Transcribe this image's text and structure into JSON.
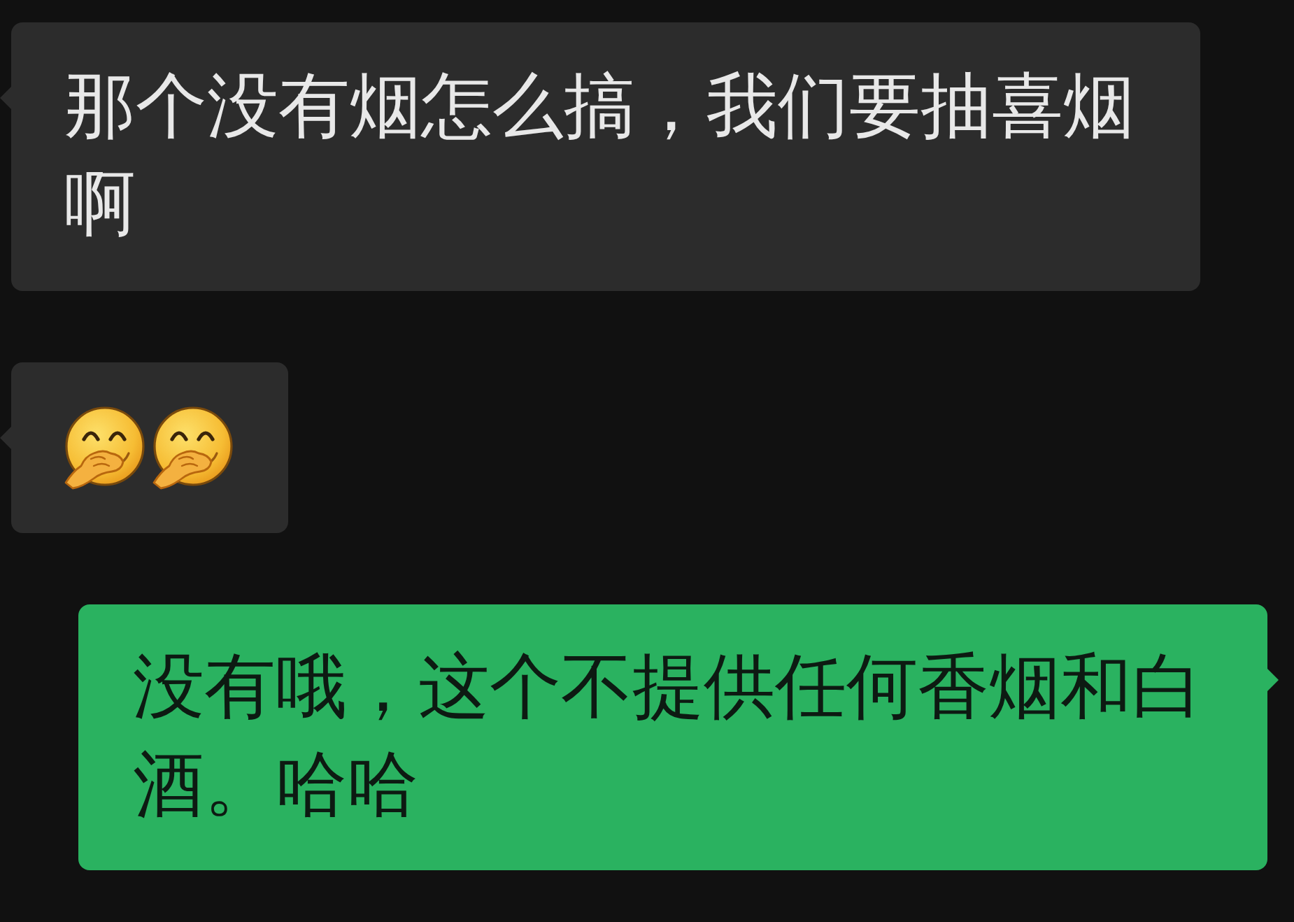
{
  "messages": [
    {
      "outgoing": false,
      "kind": "text",
      "text": "那个没有烟怎么搞，我们要抽喜烟啊"
    },
    {
      "outgoing": false,
      "kind": "emoji",
      "emoji": [
        {
          "kind": "face-hand-over-mouth"
        },
        {
          "kind": "face-hand-over-mouth"
        }
      ]
    },
    {
      "outgoing": true,
      "kind": "text",
      "text": "没有哦，这个不提供任何香烟和白酒。哈哈"
    }
  ]
}
